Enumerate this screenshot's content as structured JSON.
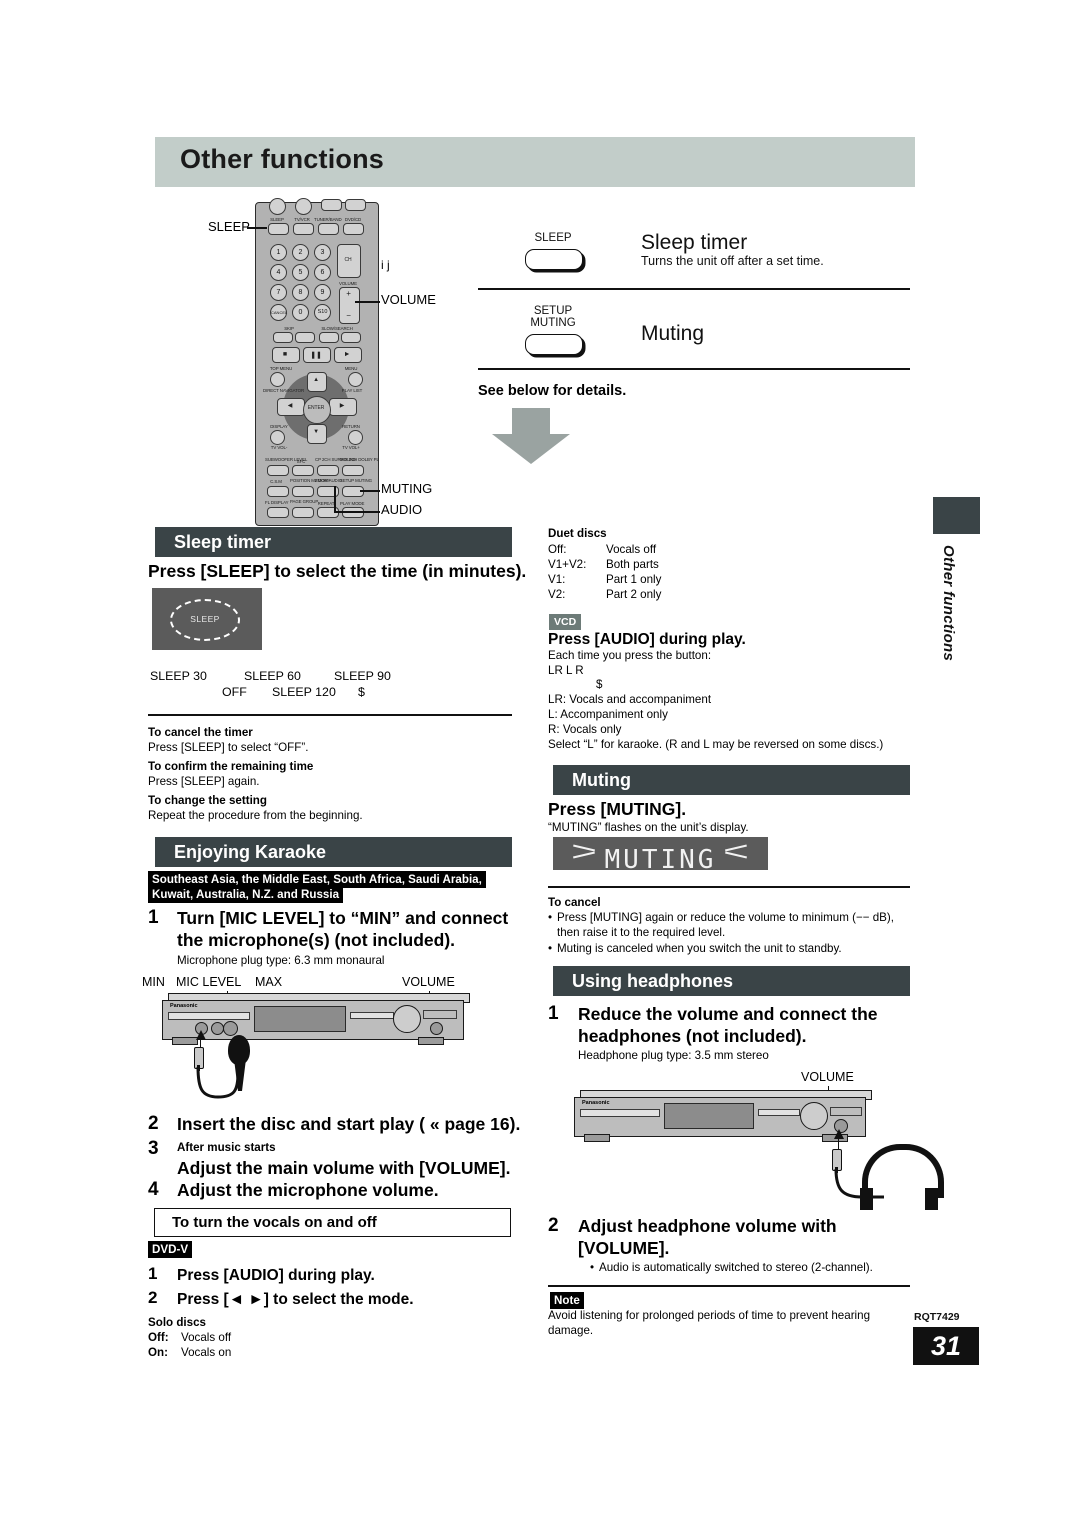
{
  "page": {
    "title": "Other functions",
    "side_tab_label": "Other functions",
    "doc_code": "RQT7429",
    "page_number": "31"
  },
  "remote": {
    "callouts": {
      "sleep": "SLEEP",
      "volume": "VOLUME",
      "volume_marks": "i j",
      "muting": "MUTING",
      "audio": "AUDIO"
    },
    "buttons": {
      "sleep": "SLEEP",
      "tv_vcr": "TV/VCR",
      "tuner_band": "TUNER/BAND",
      "dvd_cd": "DVD/CD",
      "ch": "CH",
      "volume": "VOLUME",
      "skip": "SKIP",
      "slow_search": "SLOW/SEARCH",
      "top_menu": "TOP MENU",
      "menu": "MENU",
      "direct_navigator": "DIRECT NAVIGATOR",
      "play_list": "PLAY LIST",
      "display": "DISPLAY",
      "return": "RETURN",
      "tv_vol_minus": "TV VOL-",
      "tv_vol_plus": "TV VOL+",
      "subwoofer_level": "SUBWOOFER LEVEL",
      "sfc": "SFC",
      "cinema_surround": "CP 2CH SURROUND",
      "mix_2ch_dolby_pl": "MIX 2CH DOLBY PL",
      "csm": "C.S.M",
      "position_memory": "POSITION MEMORY",
      "zoom_audio": "ZOOM AUDIO",
      "setup_muting": "SETUP MUTING",
      "fl_display": "FL DISPLAY",
      "page_group": "PAGE GROUP",
      "repeat": "REPEAT",
      "play_mode": "PLAY MODE",
      "enter": "ENTER",
      "cancel": "CANCEL",
      "zero": "0",
      "s10": "S10",
      "numbers": [
        "1",
        "2",
        "3",
        "4",
        "5",
        "6",
        "7",
        "8",
        "9"
      ]
    }
  },
  "overview": {
    "rows": [
      {
        "button_caption": "SLEEP",
        "heading": "Sleep timer",
        "sub": "Turns the unit off after a set time."
      },
      {
        "button_caption_line1": "SETUP",
        "button_caption_line2": "MUTING",
        "heading": "Muting",
        "sub": ""
      }
    ],
    "see_below": "See below for details."
  },
  "sleep_timer": {
    "section_title": "Sleep timer",
    "instruction": "Press [SLEEP] to select the time (in minutes).",
    "display_label": "SLEEP",
    "sequence_line1": [
      "SLEEP 30",
      "SLEEP 60",
      "SLEEP 90"
    ],
    "sequence_line2": [
      "OFF",
      "SLEEP 120",
      "$"
    ],
    "notes": [
      {
        "head": "To cancel the timer",
        "body": "Press [SLEEP] to select “OFF”."
      },
      {
        "head": "To confirm the remaining time",
        "body": "Press [SLEEP] again."
      },
      {
        "head": "To change the setting",
        "body": "Repeat the procedure from the beginning."
      }
    ]
  },
  "karaoke": {
    "section_title": "Enjoying Karaoke",
    "region_label_line1": "Southeast Asia, the Middle East, South Africa, Saudi Arabia,",
    "region_label_line2": "Kuwait, Australia, N.Z. and Russia",
    "steps": [
      {
        "num": "1",
        "text_line1": "Turn [MIC LEVEL] to “MIN” and connect",
        "text_line2": "the microphone(s) (not included).",
        "sub": "Microphone plug type: 6.3 mm monaural"
      },
      {
        "num": "2",
        "text_line1": "Insert the disc and start play ( «  page 16).",
        "text_line2": "",
        "sub": ""
      },
      {
        "num": "3",
        "pre": "After music starts",
        "text_line1": "Adjust the main volume with [VOLUME].",
        "text_line2": "",
        "sub": ""
      },
      {
        "num": "4",
        "text_line1": "Adjust the microphone volume.",
        "text_line2": "",
        "sub": ""
      }
    ],
    "diagram_labels": {
      "mic_min": "MIN",
      "mic_level": "MIC LEVEL",
      "mic_max": "MAX",
      "volume": "VOLUME",
      "brand": "Panasonic"
    },
    "vocals_box_title": "To turn the vocals on and off",
    "dvd_badge": "DVD-V",
    "dvd_steps": [
      {
        "num": "1",
        "text": "Press [AUDIO] during play."
      },
      {
        "num": "2",
        "text": "Press [◄ ►] to select the mode."
      }
    ],
    "solo_discs": {
      "head": "Solo discs",
      "rows": [
        {
          "key": "Off",
          "val": "Vocals off"
        },
        {
          "key": "On",
          "val": "Vocals on"
        }
      ]
    },
    "duet_discs": {
      "head": "Duet discs",
      "rows": [
        {
          "key": "Off:",
          "val": "Vocals off"
        },
        {
          "key": "V1+V2:",
          "val": "Both parts"
        },
        {
          "key": "V1:",
          "val": "Part 1 only"
        },
        {
          "key": "V2:",
          "val": "Part 2 only"
        }
      ]
    },
    "vcd": {
      "badge": "VCD",
      "head": "Press [AUDIO] during play.",
      "sub": "Each time you press the button:",
      "cycle": "LR    L    R",
      "cycle_marker": "$",
      "rows": [
        "LR: Vocals and accompaniment",
        "L:   Accompaniment only",
        "R:  Vocals only"
      ],
      "footer": "Select “L” for karaoke. (R and L may be reversed on some discs.)"
    }
  },
  "muting": {
    "section_title": "Muting",
    "instruction": "Press [MUTING].",
    "sub": "“MUTING” flashes on the unit’s display.",
    "display_text": "MUTING",
    "cancel_head": "To cancel",
    "cancel_items": [
      "Press [MUTING] again or reduce the volume to minimum (−− dB), then raise it to the required level.",
      "Muting is canceled when you switch the unit to standby."
    ]
  },
  "headphones": {
    "section_title": "Using headphones",
    "steps": [
      {
        "num": "1",
        "text_line1": "Reduce the volume and connect the",
        "text_line2": "headphones (not included).",
        "sub": "Headphone plug type:  3.5 mm stereo"
      },
      {
        "num": "2",
        "text_line1": "Adjust headphone volume with",
        "text_line2": "[VOLUME].",
        "sub": "Audio is automatically switched to stereo (2-channel)."
      }
    ],
    "diagram_labels": {
      "volume": "VOLUME",
      "brand": "Panasonic"
    },
    "note_badge": "Note",
    "note_text": "Avoid listening for prolonged periods of time to prevent hearing damage."
  },
  "colors": {
    "title_bar": "#c2cdc9",
    "section_bar": "#3a4447",
    "display_box": "#5b5b5b",
    "vcd_badge": "#6d7b78",
    "arrow": "#9aa3a1"
  }
}
